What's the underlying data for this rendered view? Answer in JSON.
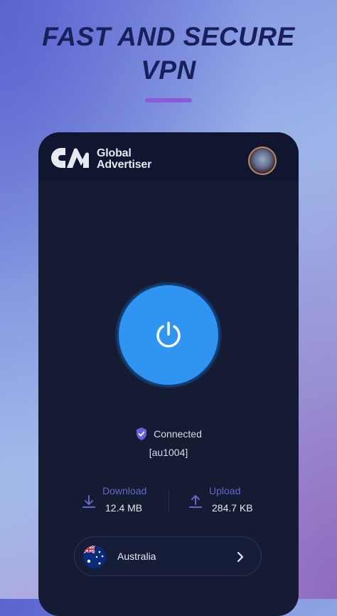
{
  "headline": {
    "line1": "FAST AND SECURE",
    "line2": "VPN"
  },
  "app": {
    "brand_line1": "Global",
    "brand_line2": "Advertiser"
  },
  "vpn": {
    "status": "Connected",
    "server": "[au1004]",
    "download_label": "Download",
    "download_value": "12.4 MB",
    "upload_label": "Upload",
    "upload_value": "284.7 KB",
    "country": "Australia"
  },
  "colors": {
    "accent": "#2f95f0",
    "stat_label": "#6468c9",
    "headline": "#17205a"
  },
  "icons": [
    "power-icon",
    "shield-check-icon",
    "download-icon",
    "upload-icon",
    "chevron-right-icon",
    "australia-flag-icon"
  ]
}
